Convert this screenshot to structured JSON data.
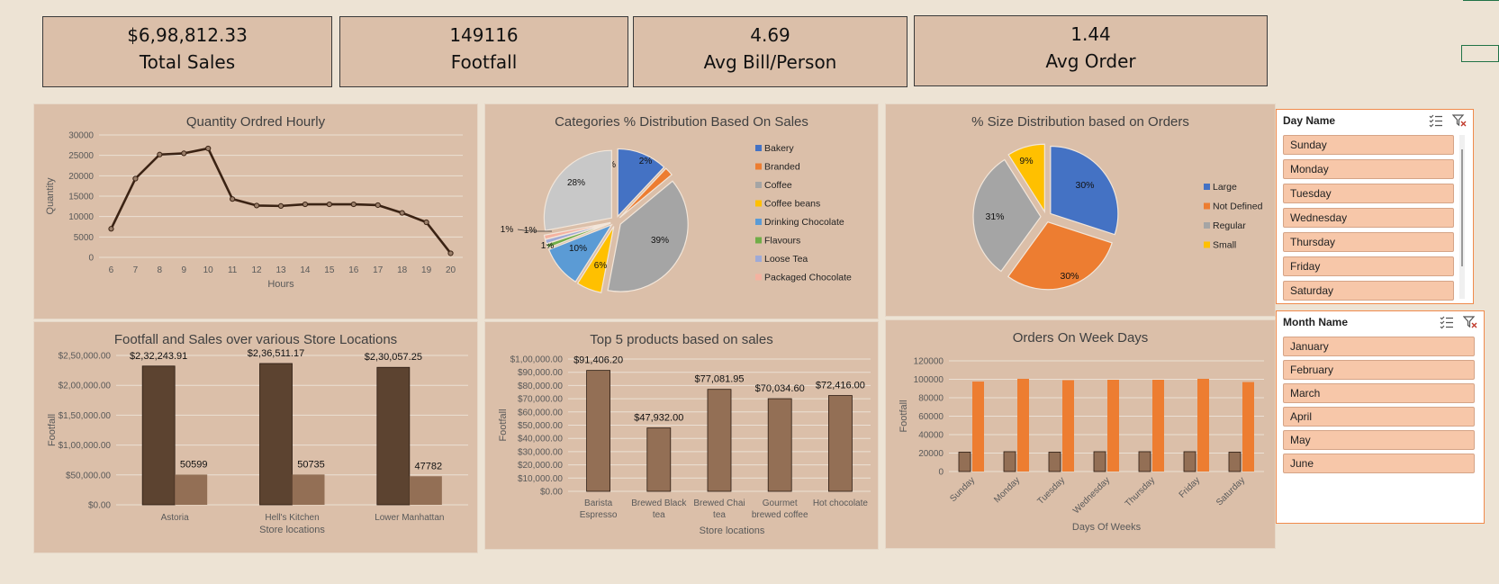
{
  "kpis": [
    {
      "value": "$6,98,812.33",
      "label": "Total Sales"
    },
    {
      "value": "149116",
      "label": "Footfall"
    },
    {
      "value": "4.69",
      "label": "Avg Bill/Person"
    },
    {
      "value": "1.44",
      "label": "Avg Order"
    }
  ],
  "slicers": {
    "day": {
      "title": "Day Name",
      "items": [
        "Sunday",
        "Monday",
        "Tuesday",
        "Wednesday",
        "Thursday",
        "Friday",
        "Saturday"
      ]
    },
    "month": {
      "title": "Month Name",
      "items": [
        "January",
        "February",
        "March",
        "April",
        "May",
        "June"
      ]
    }
  },
  "colors": {
    "panel": "#dbbfa9",
    "line": "#3b2314",
    "bar_dark": "#5c4330",
    "bar_light": "#936f55",
    "orange": "#ed7d31",
    "slicer_item": "#f7c7a9"
  },
  "chart_data": [
    {
      "type": "line",
      "title": "Quantity Ordred Hourly",
      "xlabel": "Hours",
      "ylabel": "Quantity",
      "x": [
        6,
        7,
        8,
        9,
        10,
        11,
        12,
        13,
        14,
        15,
        16,
        17,
        18,
        19,
        20
      ],
      "y": [
        7000,
        19300,
        25200,
        25500,
        26700,
        14300,
        12700,
        12600,
        13000,
        13000,
        13000,
        12800,
        10900,
        8600,
        1000
      ],
      "ylim": [
        0,
        30000
      ],
      "yticks": [
        0,
        5000,
        10000,
        15000,
        20000,
        25000,
        30000
      ],
      "grid": true
    },
    {
      "type": "pie",
      "title": "Categories %  Distribution Based On Sales",
      "labels": [
        "Bakery",
        "Branded",
        "Coffee",
        "Coffee beans",
        "Drinking Chocolate",
        "Flavours",
        "Loose Tea",
        "Packaged Chocolate"
      ],
      "values": [
        12,
        2,
        39,
        6,
        10,
        1,
        1,
        1
      ],
      "value_labels": [
        "12%",
        "2%",
        "39%",
        "6%",
        "10%",
        "1%",
        "1%",
        "1%"
      ],
      "other": {
        "label": "28%",
        "value": 28
      },
      "colors": [
        "#4472c4",
        "#ed7d31",
        "#a5a5a5",
        "#ffc000",
        "#5b9bd5",
        "#70ad47",
        "#9faad6",
        "#f4b2a0"
      ],
      "legend": "right"
    },
    {
      "type": "pie",
      "title": "% Size Distribution based on Orders",
      "labels": [
        "Large",
        "Not Defined",
        "Regular",
        "Small"
      ],
      "values": [
        30,
        30,
        31,
        9
      ],
      "value_labels": [
        "30%",
        "30%",
        "31%",
        "9%"
      ],
      "colors": [
        "#4472c4",
        "#ed7d31",
        "#a5a5a5",
        "#ffc000"
      ],
      "legend": "right"
    },
    {
      "type": "bar",
      "title": "Footfall and Sales over various Store Locations",
      "xlabel": "Store locations",
      "ylabel": "Footfall",
      "categories": [
        "Astoria",
        "Hell's Kitchen",
        "Lower Manhattan"
      ],
      "series": [
        {
          "values": [
            232243.91,
            236511.17,
            230057.25
          ],
          "labels": [
            "$2,32,243.91",
            "$2,36,511.17",
            "$2,30,057.25"
          ]
        },
        {
          "values": [
            50599,
            50735,
            47782
          ],
          "labels": [
            "50599",
            "50735",
            "47782"
          ]
        }
      ],
      "ylim": [
        0,
        250000
      ],
      "yticks": [
        0,
        50000,
        100000,
        150000,
        200000,
        250000
      ],
      "ytick_labels": [
        "$0.00",
        "$50,000.00",
        "$1,00,000.00",
        "$1,50,000.00",
        "$2,00,000.00",
        "$2,50,000.00"
      ],
      "grid": true
    },
    {
      "type": "bar",
      "title": "Top 5 products based on sales",
      "xlabel": "Store locations",
      "ylabel": "Footfall",
      "categories": [
        [
          "Barista",
          "Espresso"
        ],
        [
          "Brewed Black",
          "tea"
        ],
        [
          "Brewed Chai",
          "tea"
        ],
        [
          "Gourmet",
          "brewed coffee"
        ],
        [
          "Hot chocolate"
        ]
      ],
      "values": [
        91406.2,
        47932.0,
        77081.95,
        70034.6,
        72416.0
      ],
      "value_labels": [
        "$91,406.20",
        "$47,932.00",
        "$77,081.95",
        "$70,034.60",
        "$72,416.00"
      ],
      "ylim": [
        0,
        100000
      ],
      "yticks": [
        0,
        10000,
        20000,
        30000,
        40000,
        50000,
        60000,
        70000,
        80000,
        90000,
        100000
      ],
      "ytick_labels": [
        "$0.00",
        "$10,000.00",
        "$20,000.00",
        "$30,000.00",
        "$40,000.00",
        "$50,000.00",
        "$60,000.00",
        "$70,000.00",
        "$80,000.00",
        "$90,000.00",
        "$1,00,000.00"
      ],
      "grid": true
    },
    {
      "type": "bar",
      "title": "Orders On Week Days",
      "xlabel": "Days Of Weeks",
      "ylabel": "Footfall",
      "categories": [
        "Sunday",
        "Monday",
        "Tuesday",
        "Wednesday",
        "Thursday",
        "Friday",
        "Saturday"
      ],
      "series": [
        {
          "values": [
            21000,
            21500,
            21000,
            21500,
            21500,
            21500,
            21000
          ]
        },
        {
          "values": [
            97500,
            100500,
            99000,
            99500,
            99500,
            100500,
            97000
          ]
        }
      ],
      "ylim": [
        0,
        120000
      ],
      "yticks": [
        0,
        20000,
        40000,
        60000,
        80000,
        100000,
        120000
      ],
      "grid": true
    }
  ]
}
